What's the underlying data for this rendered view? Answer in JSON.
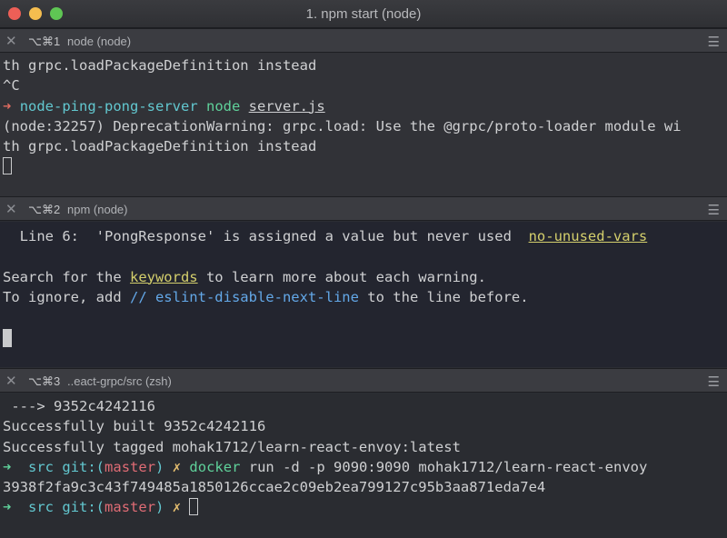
{
  "window": {
    "title": "1. npm start (node)"
  },
  "panes": [
    {
      "shortcut": "⌥⌘1",
      "title": "node (node)",
      "lines": {
        "l1": "th grpc.loadPackageDefinition instead",
        "l2": "^C",
        "l3_arrow": "➜",
        "l3_dir": "node-ping-pong-server",
        "l3_cmd": "node",
        "l3_arg": "server.js",
        "l4": "(node:32257) DeprecationWarning: grpc.load: Use the @grpc/proto-loader module wi",
        "l5": "th grpc.loadPackageDefinition instead"
      }
    },
    {
      "shortcut": "⌥⌘2",
      "title": "npm (node)",
      "lines": {
        "l1_a": "  Line 6:  'PongResponse' is assigned a value but never used  ",
        "l1_rule": "no-unused-vars",
        "l2_a": "Search for the ",
        "l2_kw": "keywords",
        "l2_b": " to learn more about each warning.",
        "l3_a": "To ignore, add ",
        "l3_cmt": "// eslint-disable-next-line",
        "l3_b": " to the line before."
      }
    },
    {
      "shortcut": "⌥⌘3",
      "title": "..eact-grpc/src (zsh)",
      "lines": {
        "l1": " ---> 9352c4242116",
        "l2": "Successfully built 9352c4242116",
        "l3": "Successfully tagged mohak1712/learn-react-envoy:latest",
        "l4_arrow": "➜",
        "l4_dir": "src",
        "l4_git": "git:(",
        "l4_branch": "master",
        "l4_git_close": ")",
        "l4_x": "✗",
        "l4_cmd": "docker",
        "l4_rest": " run -d -p 9090:9090 mohak1712/learn-react-envoy",
        "l5": "3938f2fa9c3c43f749485a1850126ccae2c09eb2ea799127c95b3aa871eda7e4",
        "l6_arrow": "➜",
        "l6_dir": "src",
        "l6_git": "git:(",
        "l6_branch": "master",
        "l6_git_close": ")",
        "l6_x": "✗"
      }
    }
  ],
  "icons": {
    "close": "close-icon",
    "menu": "hamburger-menu-icon"
  }
}
